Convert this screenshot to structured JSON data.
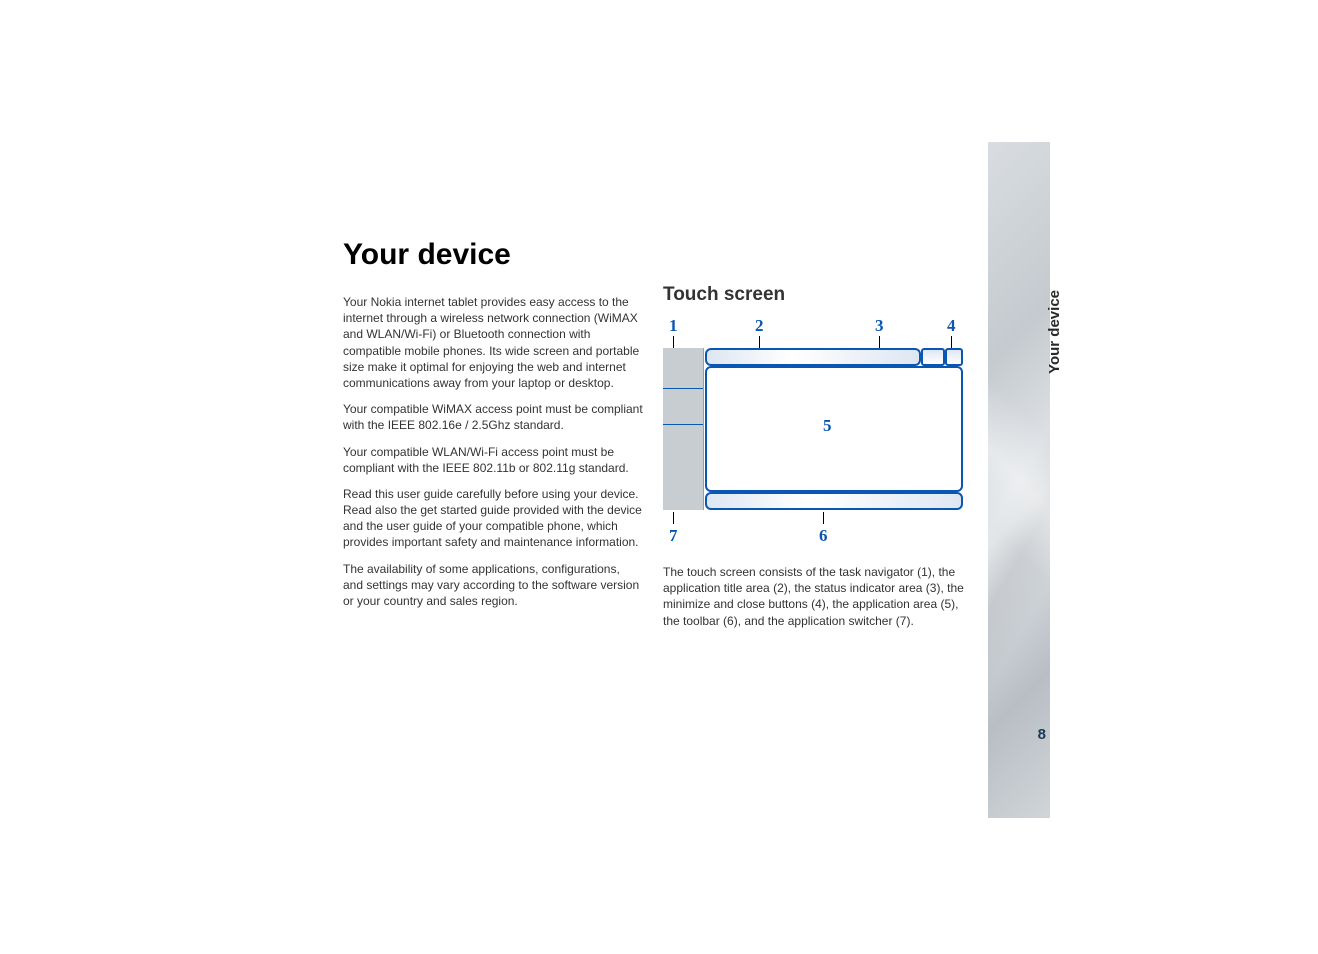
{
  "side": {
    "label": "Your device",
    "page_number": "8"
  },
  "heading": "Your device",
  "left_paragraphs": [
    "Your Nokia internet tablet provides easy access to the internet through a wireless network connection (WiMAX and WLAN/Wi-Fi) or Bluetooth connection with compatible mobile phones. Its wide screen and portable size make it optimal for enjoying the web and internet communications away from your laptop or desktop.",
    "Your compatible WiMAX access point must be compliant with the IEEE 802.16e / 2.5Ghz standard.",
    "Your compatible WLAN/Wi-Fi access point must be compliant with the IEEE 802.11b or 802.11g standard.",
    "Read this user guide carefully before using your device. Read also the get started guide provided with the device and the user guide of your compatible phone, which provides important safety and maintenance information.",
    "The availability of some applications, configurations, and settings may vary according to the software version or your country and sales region."
  ],
  "right": {
    "subheading": "Touch screen",
    "callouts": {
      "n1": "1",
      "n2": "2",
      "n3": "3",
      "n4": "4",
      "n5": "5",
      "n6": "6",
      "n7": "7"
    },
    "caption": "The touch screen consists of the task navigator (1), the application title area (2), the status indicator area (3), the minimize and close buttons (4), the application area (5), the toolbar (6), and the application switcher (7)."
  }
}
